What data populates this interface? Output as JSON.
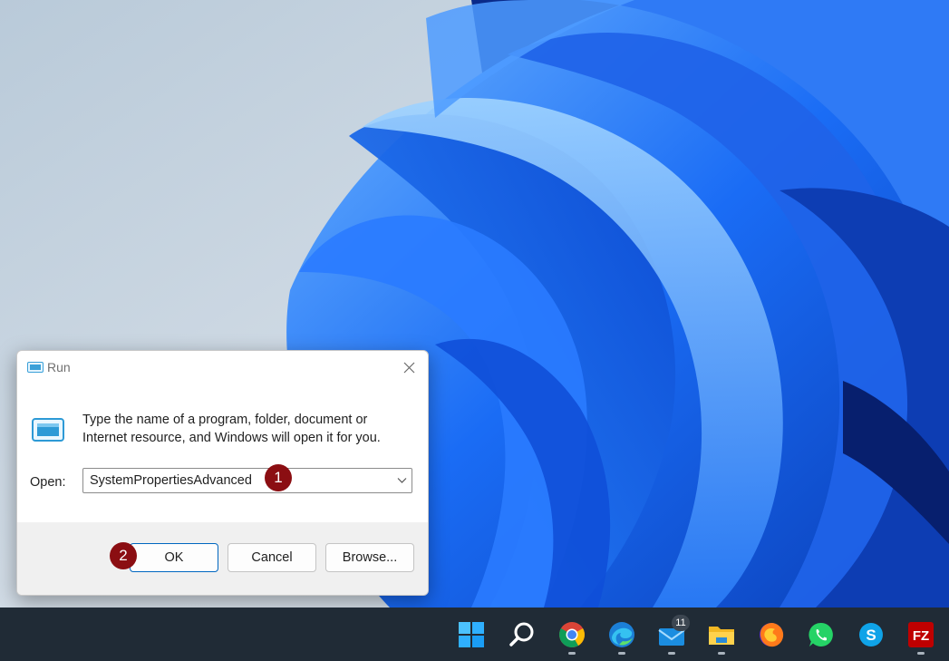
{
  "dialog": {
    "title": "Run",
    "description_line1": "Type the name of a program, folder, document or",
    "description_line2": "Internet resource, and Windows will open it for you.",
    "open_label": "Open:",
    "open_value": "SystemPropertiesAdvanced",
    "buttons": {
      "ok": "OK",
      "cancel": "Cancel",
      "browse": "Browse..."
    }
  },
  "markers": [
    "1",
    "2"
  ],
  "taskbar": {
    "items": [
      {
        "name": "start-icon"
      },
      {
        "name": "search-icon"
      },
      {
        "name": "chrome-icon"
      },
      {
        "name": "edge-icon"
      },
      {
        "name": "mail-icon",
        "badge": "11"
      },
      {
        "name": "file-explorer-icon"
      },
      {
        "name": "firefox-icon"
      },
      {
        "name": "whatsapp-icon"
      },
      {
        "name": "skype-icon"
      },
      {
        "name": "filezilla-icon"
      }
    ]
  },
  "colors": {
    "accent": "#0067c0",
    "marker": "#8b0e12",
    "taskbar": "#202b36"
  }
}
